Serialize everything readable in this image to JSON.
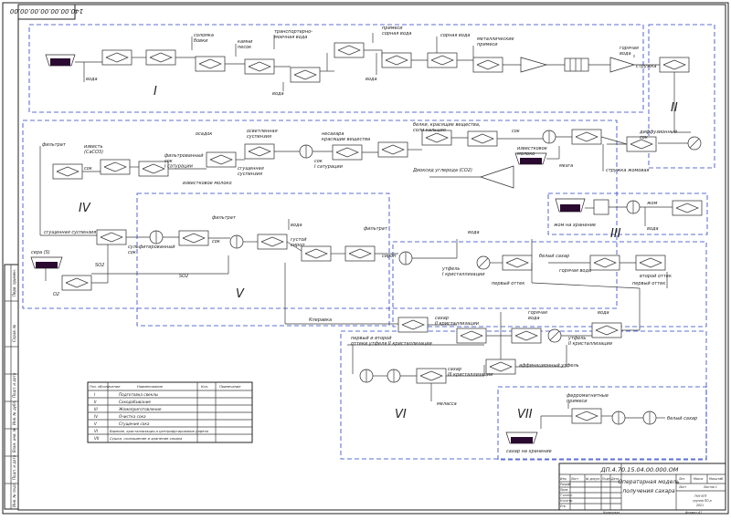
{
  "doc": {
    "stamp_code": "ДП.4.70.15.04.00.000.ОМ",
    "stamp_code_rot": "140.00.00.00.00.00.00",
    "drawing_title_line1": "Операторная модель",
    "drawing_title_line2": "получения сахара"
  },
  "zones": {
    "z1": "I",
    "z2": "II",
    "z3": "III",
    "z4": "IV",
    "z5": "V",
    "z6": "VI",
    "z7": "VII"
  },
  "labels": {
    "voda1": "вода",
    "solomka": "соломка\nбовки",
    "kamni": "камни\nпесок",
    "transport": "транспортерно-\nмоечная вода",
    "voda2": "вода",
    "primesi1": "примеси\nсорная вода",
    "voda3": "вода",
    "sornaya": "сорная вода",
    "metall": "металлические\nпримеси",
    "gor_voda1": "горячая\nвода",
    "struzhka": "стружка",
    "filtrat1": "фильтрат",
    "izvest": "известь\n(CaCO3)",
    "sok1": "сок",
    "fil_sok": "фильтрованный\nсок\nI сатурации",
    "osadok": "осадок",
    "osv_susp": "осветленная\nсуспензия",
    "gust_susp": "сгущенная\nсуспензия",
    "izv_moloko1": "известковое молоко",
    "nesahar": "несахара\nкрасящие вещества",
    "sok_sat": "сок\nI сатурации",
    "belki": "белки, красящие вещества,\nсоли кальция",
    "sok2": "сок",
    "diox": "Диоксид углерода (CO2)",
    "izv_moloko2": "известковое\nмолоко",
    "mezga": "мезга",
    "diff_sok": "диффузионный\nсок",
    "struzhka_zhom": "стружка жомовая",
    "sgush_susp": "сгущенная суспензия",
    "sera": "сера (S)",
    "o2": "O2",
    "so2_a": "SO2",
    "sulf_sok": "сульфитированный\nсок",
    "filtrat2": "фильтрат",
    "sok3": "сок",
    "so2_b": "SO2",
    "voda4": "вода",
    "sirop": "густой\nсироп",
    "filtrat3": "фильтрат",
    "sirop2": "сироп",
    "voda5": "вода",
    "utfel1": "утфель\nI кристаллизации",
    "zhom_hran": "жом на хранение",
    "zhom": "жом",
    "voda6": "вода",
    "bely_sahar1": "белый сахар",
    "gor_voda2": "горячая вода",
    "vtoroi_ottek": "второй оттек",
    "pervy_ottek1": "первый оттек",
    "pervy_ottek2": "первый оттек",
    "kleravka": "Клеравка",
    "sahar2": "сахар\nII кристаллизации",
    "pervy_vtoroi": "первый и второй\nоттеки утфеля II кристаллизации",
    "gor_voda3": "горячая\nвода",
    "voda7": "вода",
    "utfel2": "утфель\nII кристаллизации",
    "affin": "аффинационный утфель",
    "sahar3": "сахар\nIII кристаллизации",
    "melassa": "меласса",
    "ferro": "ферромагнитные\nпримеси",
    "bely_sahar2": "белый сахар",
    "sahar_hran": "сахар на хранение"
  },
  "legend": {
    "headers": [
      "Поз. обозначение",
      "Наименование",
      "Кол.",
      "Примечание"
    ],
    "rows": [
      [
        "I",
        "Подготовка свеклы"
      ],
      [
        "II",
        "Сокодобывание"
      ],
      [
        "III",
        "Жомоприготовление"
      ],
      [
        "IV",
        "Очистка сока"
      ],
      [
        "V",
        "Сгущение сока"
      ],
      [
        "VI",
        "Варение, кристаллизация и центрифугирование утфеля"
      ],
      [
        "VII",
        "Сушка, охлаждение и хранение сахара"
      ]
    ]
  },
  "titleblock": {
    "cells": [
      "Изм.",
      "Лист",
      "№ докум.",
      "Подп.",
      "Дата",
      "Разраб.",
      "Пров.",
      "Т.контр.",
      "Н.контр.",
      "Утв.",
      "Лит.",
      "Масса",
      "Масштаб",
      "Лист",
      "Листов 1"
    ],
    "org_line1": "ТНУ УПТ",
    "org_line2": "группа ПП-а",
    "org_line3": "2021",
    "kopir": "Копировал",
    "format": "Формат А1"
  },
  "sidebar": {
    "cells": [
      "Перв. примен.",
      "Справ. №",
      "Подп. и дата",
      "Инв. № дубл.",
      "Взам. инв. №",
      "Подп. и дата",
      "Инв. № подл."
    ]
  }
}
